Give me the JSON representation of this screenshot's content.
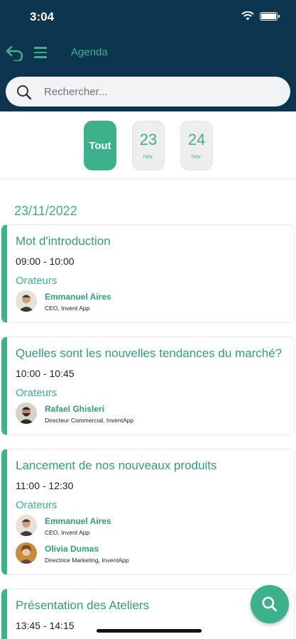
{
  "status_bar": {
    "time": "3:04"
  },
  "nav": {
    "title": "Agenda"
  },
  "search": {
    "placeholder": "Rechercher..."
  },
  "date_filter": {
    "all_label": "Tout",
    "days": [
      {
        "day": "23",
        "month": "nov."
      },
      {
        "day": "24",
        "month": "nov."
      }
    ]
  },
  "agenda": {
    "date": "23/11/2022",
    "sessions": [
      {
        "title": "Mot d'introduction",
        "time": "09:00 - 10:00",
        "speakers_label": "Orateurs",
        "speakers": [
          {
            "name": "Emmanuel Aires",
            "role": "CEO, Invent App"
          }
        ]
      },
      {
        "title": "Quelles sont les nouvelles tendances du marché?",
        "time": "10:00 - 10:45",
        "speakers_label": "Orateurs",
        "speakers": [
          {
            "name": "Rafael Ghisleri",
            "role": "Directeur Commercial, InventApp"
          }
        ]
      },
      {
        "title": "Lancement de nos nouveaux produits",
        "time": "11:00 - 12:30",
        "speakers_label": "Orateurs",
        "speakers": [
          {
            "name": "Emmanuel Aires",
            "role": "CEO, Invent App"
          },
          {
            "name": "Olivia Dumas",
            "role": "Directrice Marketing, InventApp"
          }
        ]
      },
      {
        "title": "Présentation des Ateliers",
        "time": "13:45 - 14:15"
      }
    ]
  },
  "colors": {
    "header": "#0e3550",
    "accent": "#3db08c"
  },
  "icons": {
    "back": "back-arrow-icon",
    "menu": "menu-icon",
    "search": "search-icon",
    "fab": "search-icon"
  }
}
